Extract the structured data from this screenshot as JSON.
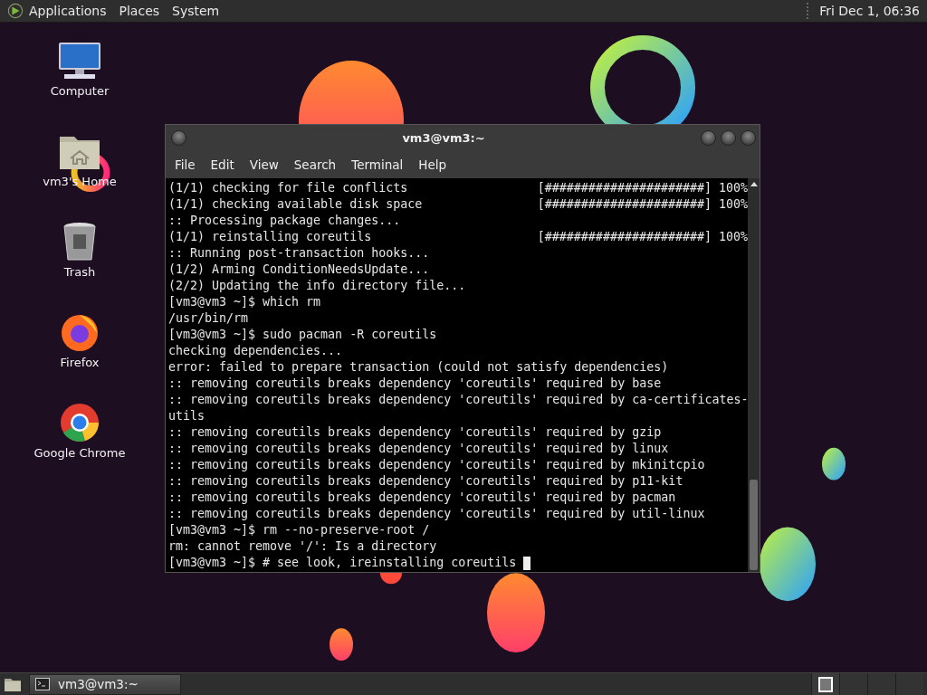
{
  "top_panel": {
    "menus": [
      "Applications",
      "Places",
      "System"
    ],
    "clock": "Fri Dec 1, 06:36"
  },
  "desktop_icons": [
    {
      "kind": "computer",
      "label": "Computer"
    },
    {
      "kind": "home",
      "label": "vm3's Home"
    },
    {
      "kind": "trash",
      "label": "Trash"
    },
    {
      "kind": "firefox",
      "label": "Firefox"
    },
    {
      "kind": "chrome",
      "label": "Google Chrome"
    }
  ],
  "window": {
    "title": "vm3@vm3:~",
    "menu": [
      "File",
      "Edit",
      "View",
      "Search",
      "Terminal",
      "Help"
    ],
    "lines": [
      {
        "text": "(1/1) checking for file conflicts",
        "progress": "[######################] 100%"
      },
      {
        "text": "(1/1) checking available disk space",
        "progress": "[######################] 100%"
      },
      {
        "text": ":: Processing package changes..."
      },
      {
        "text": "(1/1) reinstalling coreutils",
        "progress": "[######################] 100%"
      },
      {
        "text": ":: Running post-transaction hooks..."
      },
      {
        "text": "(1/2) Arming ConditionNeedsUpdate..."
      },
      {
        "text": "(2/2) Updating the info directory file..."
      },
      {
        "text": "[vm3@vm3 ~]$ which rm"
      },
      {
        "text": "/usr/bin/rm"
      },
      {
        "text": "[vm3@vm3 ~]$ sudo pacman -R coreutils"
      },
      {
        "text": "checking dependencies..."
      },
      {
        "text": "error: failed to prepare transaction (could not satisfy dependencies)"
      },
      {
        "text": ":: removing coreutils breaks dependency 'coreutils' required by base"
      },
      {
        "text": ":: removing coreutils breaks dependency 'coreutils' required by ca-certificates-"
      },
      {
        "text": "utils"
      },
      {
        "text": ":: removing coreutils breaks dependency 'coreutils' required by gzip"
      },
      {
        "text": ":: removing coreutils breaks dependency 'coreutils' required by linux"
      },
      {
        "text": ":: removing coreutils breaks dependency 'coreutils' required by mkinitcpio"
      },
      {
        "text": ":: removing coreutils breaks dependency 'coreutils' required by p11-kit"
      },
      {
        "text": ":: removing coreutils breaks dependency 'coreutils' required by pacman"
      },
      {
        "text": ":: removing coreutils breaks dependency 'coreutils' required by util-linux"
      },
      {
        "text": "[vm3@vm3 ~]$ rm --no-preserve-root /"
      },
      {
        "text": "rm: cannot remove '/': Is a directory"
      },
      {
        "text": "[vm3@vm3 ~]$ # see look, ireinstalling coreutils",
        "cursor": true
      }
    ]
  },
  "bottom_panel": {
    "task": "vm3@vm3:~",
    "workspaces": [
      {
        "selected": true
      },
      {
        "selected": false
      },
      {
        "selected": false
      },
      {
        "selected": false
      }
    ]
  }
}
